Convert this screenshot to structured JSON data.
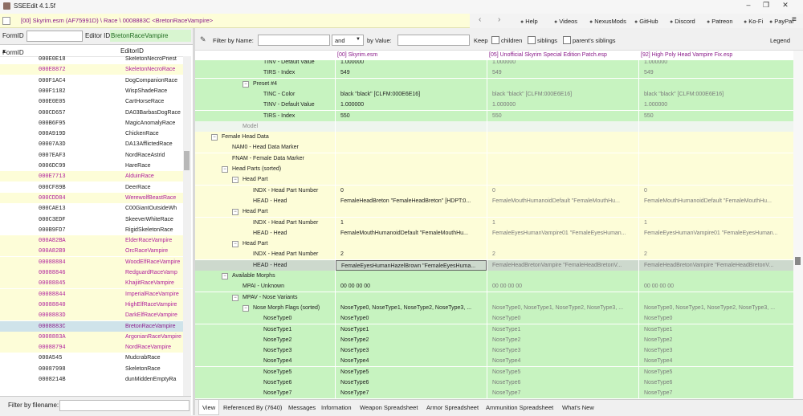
{
  "window": {
    "title": "SSEEdit 4.1.5f",
    "controls": [
      "–",
      "❐",
      "✕"
    ]
  },
  "toolbar": {
    "path": "[00] Skyrim.esm (AF75991D) \\ Race \\ 0008883C <BretonRaceVampire>",
    "back": "‹",
    "forward": "›",
    "links": [
      {
        "label": "Help",
        "icon": "help-icon"
      },
      {
        "label": "Videos",
        "icon": "video-icon"
      },
      {
        "label": "NexusMods",
        "icon": "nexus-icon"
      },
      {
        "label": "GitHub",
        "icon": "github-icon"
      },
      {
        "label": "Discord",
        "icon": "discord-icon"
      },
      {
        "label": "Patreon",
        "icon": "patreon-icon"
      },
      {
        "label": "Ko-Fi",
        "icon": "kofi-icon"
      },
      {
        "label": "PayPal",
        "icon": "paypal-icon"
      }
    ],
    "menu_icon": "≡"
  },
  "left": {
    "formid_label": "FormID",
    "editorid_label": "Editor ID",
    "editorid_value": "BretonRaceVampire",
    "col_formid": "FormID",
    "col_editorid": "EditorID",
    "rows": [
      {
        "fid": "000E0E18",
        "eid": "SkeletonNecroPriest",
        "state": "normal"
      },
      {
        "fid": "000E8872",
        "eid": "SkeletonNecroRace",
        "state": "hl"
      },
      {
        "fid": "000F1AC4",
        "eid": "DogCompanionRace",
        "state": "normal"
      },
      {
        "fid": "000F1182",
        "eid": "WispShadeRace",
        "state": "normal"
      },
      {
        "fid": "000E0E05",
        "eid": "CartHorseRace",
        "state": "normal"
      },
      {
        "fid": "000CD657",
        "eid": "DA03BarbasDogRace",
        "state": "normal"
      },
      {
        "fid": "000B6F95",
        "eid": "MagicAnomalyRace",
        "state": "normal"
      },
      {
        "fid": "000A919D",
        "eid": "ChickenRace",
        "state": "normal"
      },
      {
        "fid": "00007A3D",
        "eid": "DA13AfflictedRace",
        "state": "normal"
      },
      {
        "fid": "0007EAF3",
        "eid": "NordRaceAstrid",
        "state": "normal"
      },
      {
        "fid": "0006DC99",
        "eid": "HareRace",
        "state": "normal"
      },
      {
        "fid": "000E7713",
        "eid": "AlduinRace",
        "state": "hl"
      },
      {
        "fid": "000CF89B",
        "eid": "DeerRace",
        "state": "normal"
      },
      {
        "fid": "000CDD84",
        "eid": "WerewolfBeastRace",
        "state": "hl"
      },
      {
        "fid": "000CAE13",
        "eid": "C00GiantOutsideWh",
        "state": "normal"
      },
      {
        "fid": "000C3EDF",
        "eid": "SkeeverWhiteRace",
        "state": "normal"
      },
      {
        "fid": "000B9FD7",
        "eid": "RigidSkeletonRace",
        "state": "normal"
      },
      {
        "fid": "000A82BA",
        "eid": "ElderRaceVampire",
        "state": "hl"
      },
      {
        "fid": "000A82B9",
        "eid": "OrcRaceVampire",
        "state": "hl"
      },
      {
        "fid": "00088884",
        "eid": "WoodElfRaceVampire",
        "state": "hl"
      },
      {
        "fid": "00088846",
        "eid": "RedguardRaceVamp",
        "state": "hl"
      },
      {
        "fid": "00088845",
        "eid": "KhajiitRaceVampire",
        "state": "hl"
      },
      {
        "fid": "00088844",
        "eid": "ImperialRaceVampire",
        "state": "hl"
      },
      {
        "fid": "00088840",
        "eid": "HighElfRaceVampire",
        "state": "hl"
      },
      {
        "fid": "0008883D",
        "eid": "DarkElfRaceVampire",
        "state": "hl"
      },
      {
        "fid": "0008883C",
        "eid": "BretonRaceVampire",
        "state": "sel"
      },
      {
        "fid": "0008883A",
        "eid": "ArgonianRaceVampire",
        "state": "hl"
      },
      {
        "fid": "00088794",
        "eid": "NordRaceVampire",
        "state": "hl"
      },
      {
        "fid": "000A545",
        "eid": "MudcrabRace",
        "state": "normal"
      },
      {
        "fid": "00087998",
        "eid": "SkeletonRace",
        "state": "normal"
      },
      {
        "fid": "0008214B",
        "eid": "dunMiddenEmptyRa",
        "state": "normal"
      }
    ],
    "filter_label": "Filter by filename:"
  },
  "right": {
    "filter_by_name": "Filter by Name:",
    "and_select": "and",
    "by_value": "by Value:",
    "keep": "Keep",
    "children": "children",
    "siblings": "siblings",
    "parents_siblings": "parent's siblings",
    "legend": "Legend",
    "col1": "[00] Skyrim.esm",
    "col2": "[05] Unofficial Skyrim Special Edition Patch.esp",
    "col3": "[92] High Poly Head Vampire Fix.esp",
    "rows": [
      {
        "indent": 4,
        "exp": "",
        "label": "TINV - Default Value",
        "v1": "1.000000",
        "v2": "1.000000",
        "v3": "1.000000",
        "style": "green"
      },
      {
        "indent": 4,
        "exp": "",
        "label": "TIRS - Index",
        "v1": "549",
        "v2": "549",
        "v3": "549",
        "style": "green"
      },
      {
        "indent": 3,
        "exp": "−",
        "label": "Preset #4",
        "v1": "",
        "v2": "",
        "v3": "",
        "style": "green"
      },
      {
        "indent": 4,
        "exp": "",
        "label": "TINC - Color",
        "v1": "black \"black\" [CLFM:000E6E16]",
        "v2": "black \"black\" [CLFM:000E6E16]",
        "v3": "black \"black\" [CLFM:000E6E16]",
        "style": "green"
      },
      {
        "indent": 4,
        "exp": "",
        "label": "TINV - Default Value",
        "v1": "1.000000",
        "v2": "1.000000",
        "v3": "1.000000",
        "style": "green"
      },
      {
        "indent": 4,
        "exp": "",
        "label": "TIRS - Index",
        "v1": "550",
        "v2": "550",
        "v3": "550",
        "style": "green"
      },
      {
        "indent": 2,
        "exp": "",
        "label": "Model",
        "v1": "",
        "v2": "",
        "v3": "",
        "style": "grey"
      },
      {
        "indent": 0,
        "exp": "−",
        "label": "Female Head Data",
        "v1": "",
        "v2": "",
        "v3": "",
        "style": "yellow"
      },
      {
        "indent": 1,
        "exp": "",
        "label": "NAM0 - Head Data Marker",
        "v1": "",
        "v2": "",
        "v3": "",
        "style": "yellow"
      },
      {
        "indent": 1,
        "exp": "",
        "label": "FNAM - Female Data Marker",
        "v1": "",
        "v2": "",
        "v3": "",
        "style": "yellow"
      },
      {
        "indent": 1,
        "exp": "−",
        "label": "Head Parts (sorted)",
        "v1": "",
        "v2": "",
        "v3": "",
        "style": "yellow"
      },
      {
        "indent": 2,
        "exp": "−",
        "label": "Head Part",
        "v1": "",
        "v2": "",
        "v3": "",
        "style": "yellow"
      },
      {
        "indent": 3,
        "exp": "",
        "label": "INDX - Head Part Number",
        "v1": "0",
        "v2": "0",
        "v3": "0",
        "style": "yellow"
      },
      {
        "indent": 3,
        "exp": "",
        "label": "HEAD - Head",
        "v1": "FemaleHeadBreton \"FemaleHeadBreton\" [HDPT:0...",
        "v2": "FemaleMouthHumanoidDefault \"FemaleMouthHu...",
        "v3": "FemaleMouthHumanoidDefault \"FemaleMouthHu...",
        "style": "yellow"
      },
      {
        "indent": 2,
        "exp": "−",
        "label": "Head Part",
        "v1": "",
        "v2": "",
        "v3": "",
        "style": "yellow"
      },
      {
        "indent": 3,
        "exp": "",
        "label": "INDX - Head Part Number",
        "v1": "1",
        "v2": "1",
        "v3": "1",
        "style": "yellow"
      },
      {
        "indent": 3,
        "exp": "",
        "label": "HEAD - Head",
        "v1": "FemaleMouthHumanoidDefault \"FemaleMouthHu...",
        "v2": "FemaleEyesHumanVampire01 \"FemaleEyesHuman...",
        "v3": "FemaleEyesHumanVampire01 \"FemaleEyesHuman...",
        "style": "yellow"
      },
      {
        "indent": 2,
        "exp": "−",
        "label": "Head Part",
        "v1": "",
        "v2": "",
        "v3": "",
        "style": "yellow"
      },
      {
        "indent": 3,
        "exp": "",
        "label": "INDX - Head Part Number",
        "v1": "2",
        "v2": "2",
        "v3": "2",
        "style": "yellow"
      },
      {
        "indent": 3,
        "exp": "",
        "label": "HEAD - Head",
        "v1": "FemaleEyesHumanHazelBrown \"FemaleEyesHuma...",
        "v2": "FemaleHeadBretonVampire \"FemaleHeadBretonV...",
        "v3": "FemaleHeadBretonVampire \"FemaleHeadBretonV...",
        "style": "selrow"
      },
      {
        "indent": 1,
        "exp": "−",
        "label": "Available Morphs",
        "v1": "",
        "v2": "",
        "v3": "",
        "style": "green"
      },
      {
        "indent": 2,
        "exp": "",
        "label": "MPAI - Unknown",
        "v1": "00 00 00 00",
        "v2": "00 00 00 00",
        "v3": "00 00 00 00",
        "style": "green"
      },
      {
        "indent": 2,
        "exp": "−",
        "label": "MPAV - Nose Variants",
        "v1": "",
        "v2": "",
        "v3": "",
        "style": "green"
      },
      {
        "indent": 3,
        "exp": "−",
        "label": "Nose Morph Flags (sorted)",
        "v1": "NoseType0, NoseType1, NoseType2, NoseType3, ...",
        "v2": "NoseType0, NoseType1, NoseType2, NoseType3, ...",
        "v3": "NoseType0, NoseType1, NoseType2, NoseType3, ...",
        "style": "green"
      },
      {
        "indent": 4,
        "exp": "",
        "label": "NoseType0",
        "v1": "NoseType0",
        "v2": "NoseType0",
        "v3": "NoseType0",
        "style": "green"
      },
      {
        "indent": 4,
        "exp": "",
        "label": "NoseType1",
        "v1": "NoseType1",
        "v2": "NoseType1",
        "v3": "NoseType1",
        "style": "green"
      },
      {
        "indent": 4,
        "exp": "",
        "label": "NoseType2",
        "v1": "NoseType2",
        "v2": "NoseType2",
        "v3": "NoseType2",
        "style": "green"
      },
      {
        "indent": 4,
        "exp": "",
        "label": "NoseType3",
        "v1": "NoseType3",
        "v2": "NoseType3",
        "v3": "NoseType3",
        "style": "green"
      },
      {
        "indent": 4,
        "exp": "",
        "label": "NoseType4",
        "v1": "NoseType4",
        "v2": "NoseType4",
        "v3": "NoseType4",
        "style": "green"
      },
      {
        "indent": 4,
        "exp": "",
        "label": "NoseType5",
        "v1": "NoseType5",
        "v2": "NoseType5",
        "v3": "NoseType5",
        "style": "green"
      },
      {
        "indent": 4,
        "exp": "",
        "label": "NoseType6",
        "v1": "NoseType6",
        "v2": "NoseType6",
        "v3": "NoseType6",
        "style": "green"
      },
      {
        "indent": 4,
        "exp": "",
        "label": "NoseType7",
        "v1": "NoseType7",
        "v2": "NoseType7",
        "v3": "NoseType7",
        "style": "green"
      }
    ],
    "tabs": [
      "View",
      "Referenced By (7640)",
      "Messages",
      "Information",
      "Weapon Spreadsheet",
      "Armor Spreadsheet",
      "Ammunition Spreadsheet",
      "What's New"
    ]
  }
}
